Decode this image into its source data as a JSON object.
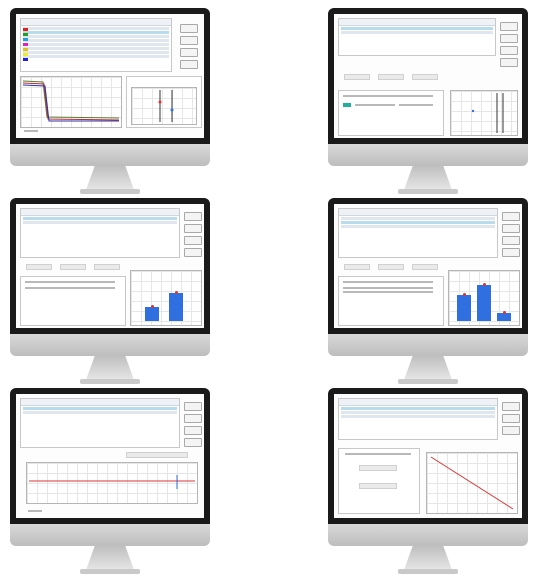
{
  "image": {
    "description_free": true
  },
  "monitors": [
    {
      "id": "monitor-1",
      "position_name": "top-left",
      "content": "multi-series-table-with-line-chart"
    },
    {
      "id": "monitor-2",
      "position_name": "top-right",
      "content": "table-with-selection-and-detail-chart"
    },
    {
      "id": "monitor-3",
      "position_name": "middle-left",
      "content": "table-with-two-bar-chart"
    },
    {
      "id": "monitor-4",
      "position_name": "middle-right",
      "content": "table-with-three-bar-chart"
    },
    {
      "id": "monitor-5",
      "position_name": "bottom-left",
      "content": "table-with-flat-line-chart"
    },
    {
      "id": "monitor-6",
      "position_name": "bottom-right",
      "content": "table-with-descending-line-chart"
    }
  ],
  "colors": {
    "bezel": "#1a1a1a",
    "screen": "#fdfdfd",
    "stand": "#c9c9c9",
    "selection": "#b9dcec",
    "bar_blue": "#2f6fe0",
    "line_red": "#d33333",
    "series_colors": [
      "#e02020",
      "#20a020",
      "#20a0e0",
      "#e020c0",
      "#e0c020",
      "#f0f020",
      "#2020e0"
    ]
  },
  "charts": {
    "monitor_3_bars": {
      "type": "bar",
      "values": [
        0.45,
        0.9
      ]
    },
    "monitor_4_bars": {
      "type": "bar",
      "values": [
        0.7,
        0.9,
        0.22
      ]
    },
    "monitor_6_line": {
      "type": "line",
      "trend": "descending"
    },
    "monitor_5_line": {
      "type": "line",
      "trend": "flat"
    }
  }
}
